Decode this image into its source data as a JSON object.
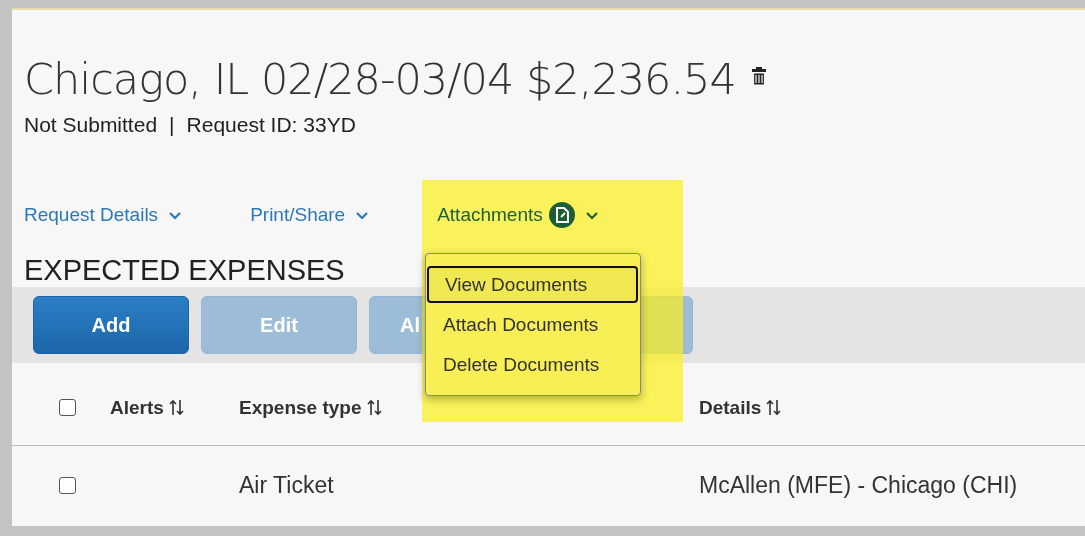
{
  "header": {
    "title": "Chicago, IL 02/28-03/04 $2,236.54",
    "status": "Not Submitted",
    "separator": "|",
    "request_id": "Request ID: 33YD"
  },
  "nav": [
    {
      "label": "Request Details",
      "kind": "menu"
    },
    {
      "label": "Print/Share",
      "kind": "menu"
    },
    {
      "label": "Attachments",
      "kind": "attachments"
    }
  ],
  "section_title": "EXPECTED EXPENSES",
  "toolbar": [
    {
      "label": "Add",
      "disabled": false
    },
    {
      "label": "Edit",
      "disabled": true
    },
    {
      "label": "Al",
      "disabled": true
    },
    {
      "disabled": true
    }
  ],
  "dropdown": {
    "items": [
      {
        "label": "View Documents",
        "selected": true
      },
      {
        "label": "Attach Documents",
        "selected": false
      },
      {
        "label": "Delete Documents",
        "selected": false
      }
    ]
  },
  "table": {
    "select_all": {
      "checked": false
    },
    "columns": [
      {
        "label": "Alerts",
        "sortable": true
      },
      {
        "label": "Expense type",
        "sortable": true
      },
      {
        "label": "Details",
        "sortable": true
      }
    ],
    "rows": [
      {
        "checked": false,
        "cells": [
          "",
          "Air Ticket",
          "McAllen (MFE) - Chicago (CHI)"
        ]
      }
    ]
  }
}
